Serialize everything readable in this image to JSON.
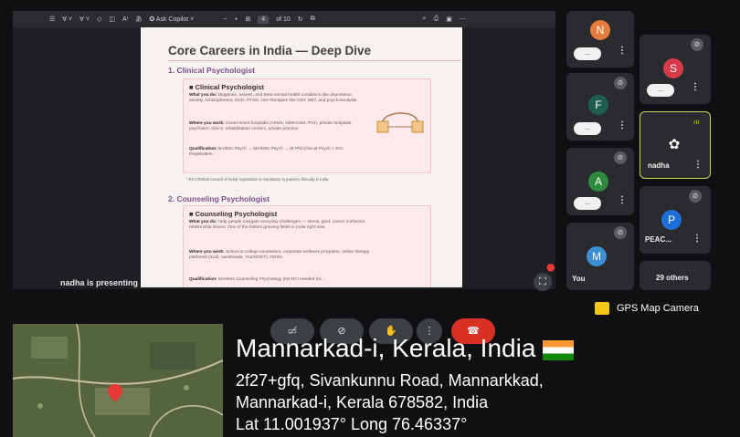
{
  "toolbar": {
    "ask_copilot": "Ask Copilot",
    "zoom_minus": "−",
    "zoom_plus": "+",
    "page_current": "4",
    "page_total": "of 10"
  },
  "document": {
    "title": "Core Careers in India — Deep Dive",
    "section1_heading": "1. Clinical Psychologist",
    "card1_title": "■ Clinical Psychologist",
    "card1_what_label": "What you do:",
    "card1_what_text": "Diagnose, assess, and treat mental health conditions like depression, anxiety, schizophrenia, OCD, PTSD. Use therapies like CBT, DBT, and psychoanalysis.",
    "card1_where_label": "Where you work:",
    "card1_where_text": "Government hospitals (AIIMS, NIMHANS, PGI), private hospitals, psychiatric clinics, rehabilitation centers, private practice.",
    "card1_qual_label": "Qualification:",
    "card1_qual_text": "BA/BSc Psych → MA/MSc Psych → M.Phil Clinical Psych + RCI Registration",
    "footnote": "* RCI (Rehab Council of India) registration is mandatory to practice clinically in India.",
    "section2_heading": "2. Counseling Psychologist",
    "card2_title": "■ Counseling Psychologist",
    "card2_what_label": "What you do:",
    "card2_what_text": "Help people navigate everyday challenges — stress, grief, career confusion, relationship issues. One of the fastest growing fields in India right now.",
    "card2_where_label": "Where you work:",
    "card2_where_text": "School & college counselors, corporate wellness programs, online therapy platforms (iCall, Vandrevala, YourDOST), NGOs.",
    "card2_qual_label": "Qualification:",
    "card2_qual_text": "MA/MSc Counseling Psychology (No RCI needed for..."
  },
  "presenter_caption": "nadha is presenting",
  "participants": [
    {
      "initial": "N",
      "color": "#e67c3b"
    },
    {
      "initial": "S",
      "color": "#d93a49"
    },
    {
      "initial": "F",
      "color": "#1e5e4e"
    },
    {
      "name": "nadha"
    },
    {
      "initial": "A",
      "color": "#2e8b3c"
    },
    {
      "initial": "P",
      "color": "#1e6fd9",
      "name": "PEAC..."
    },
    {
      "initial": "M",
      "color": "#3d8fd1",
      "name": "You"
    },
    {
      "others": "29 others"
    }
  ],
  "pill_text": "...",
  "gps": {
    "label": "GPS Map Camera",
    "title": "Mannarkad-i, Kerala, India",
    "line1": "2f27+gfq, Sivankunnu Road, Mannarkkad,",
    "line2": "Mannarkad-i, Kerala 678582, India",
    "line3": "Lat 11.001937° Long 76.46337°"
  }
}
